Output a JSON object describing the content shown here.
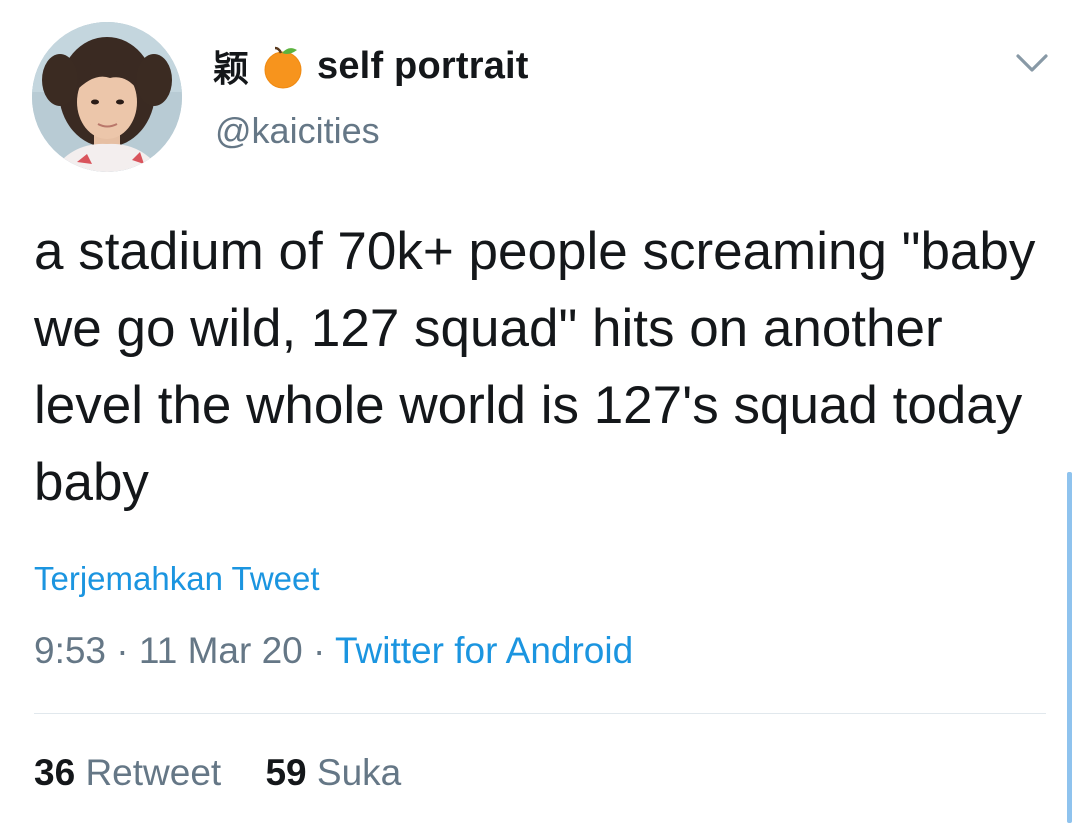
{
  "author": {
    "display_prefix": "颖",
    "emoji_icon": "orange-fruit-icon",
    "display_name": "self portrait",
    "handle": "@kaicities"
  },
  "tweet": {
    "text": "a stadium of 70k+ people screaming \"baby we go wild, 127 squad\" hits on another level the whole world is 127's squad today baby",
    "translate_label": "Terjemahkan Tweet",
    "time": "9:53",
    "date": "11 Mar 20",
    "separator": "·",
    "source": "Twitter for Android"
  },
  "stats": {
    "retweets_count": "36",
    "retweets_label": "Retweet",
    "likes_count": "59",
    "likes_label": "Suka"
  },
  "colors": {
    "link": "#1b95e0",
    "secondary_text": "#657786",
    "primary_text": "#14171a",
    "divider": "#e1e8ed",
    "orange": "#f7941d"
  },
  "icons": {
    "menu": "chevron-down-icon",
    "avatar": "profile-photo"
  }
}
